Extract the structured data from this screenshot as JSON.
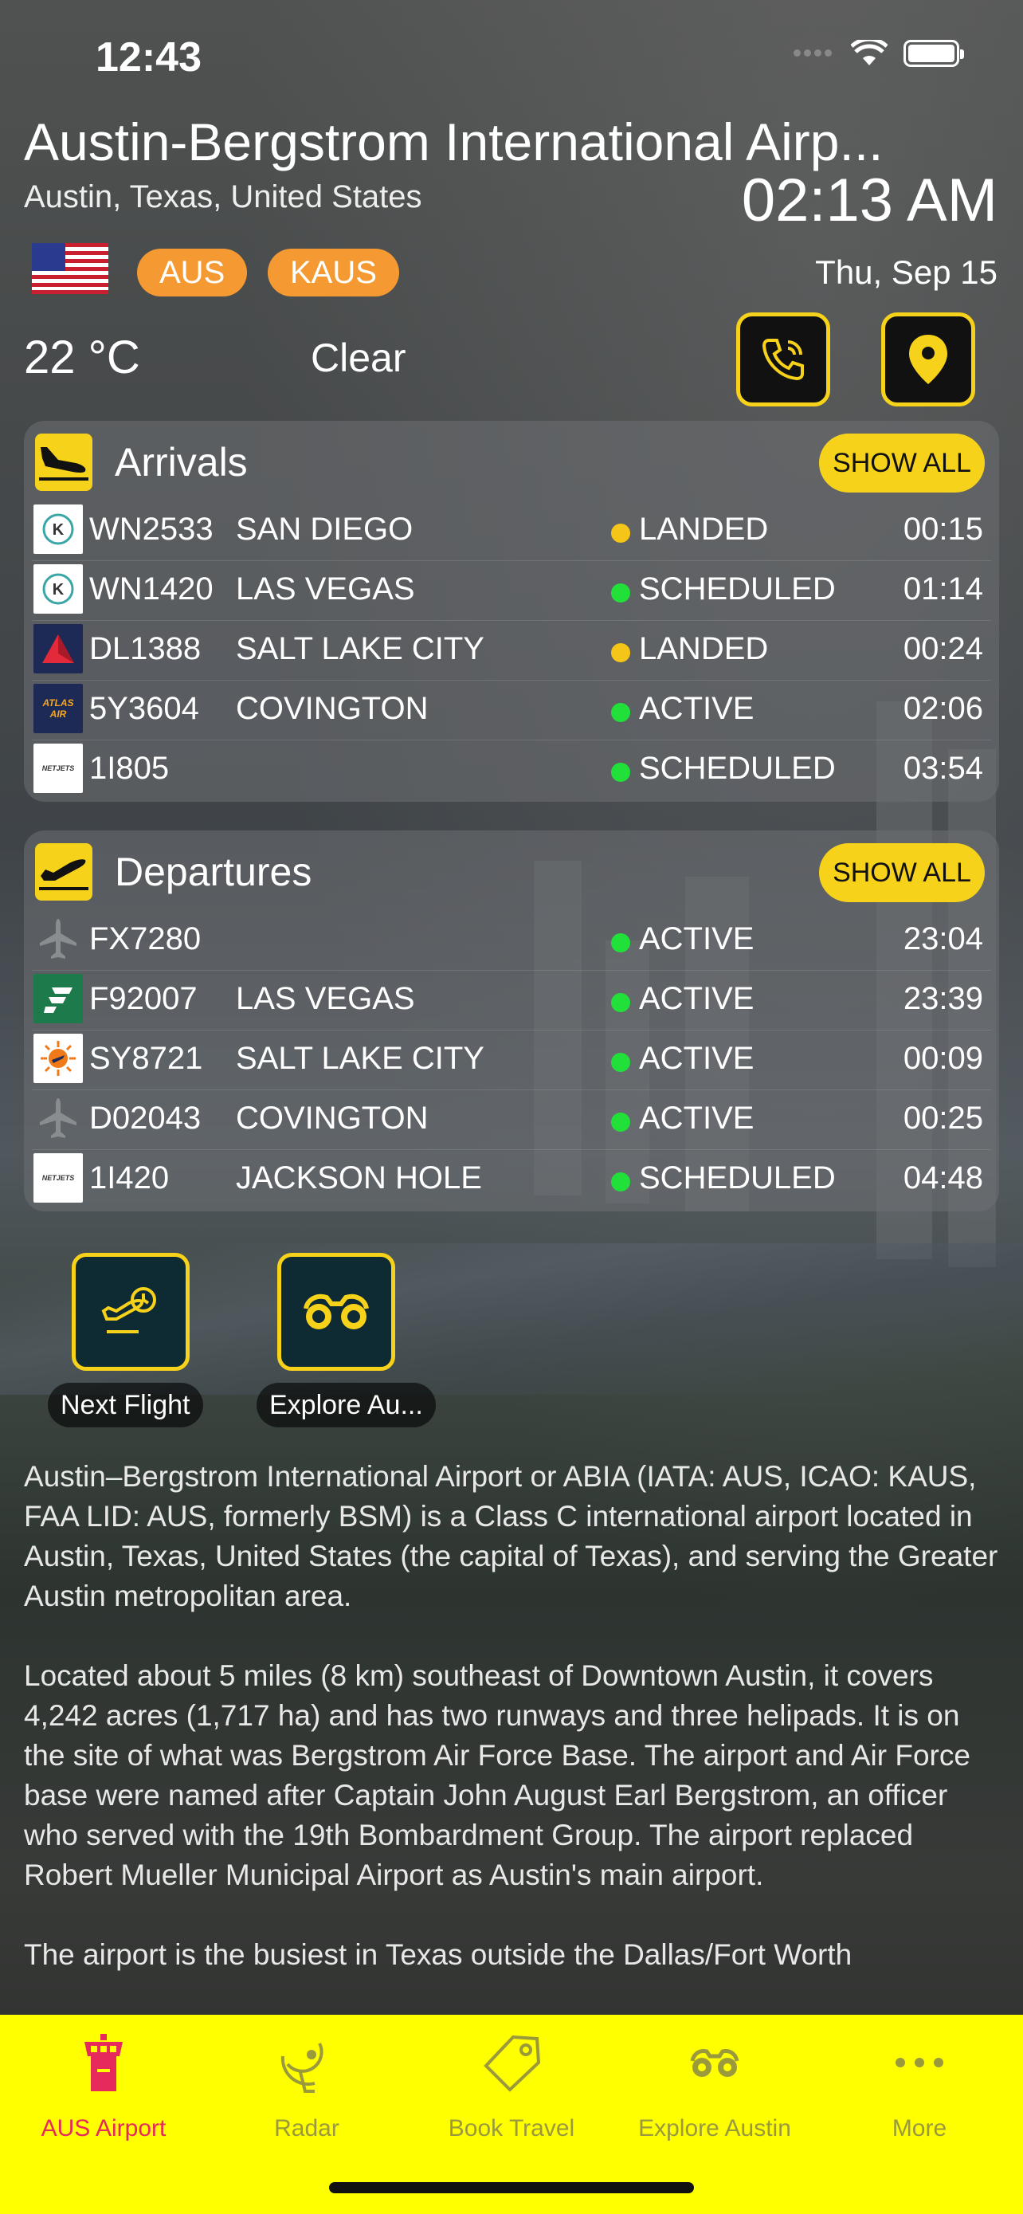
{
  "status_bar": {
    "time": "12:43"
  },
  "airport": {
    "name": "Austin-Bergstrom International Airp...",
    "location": "Austin, Texas, United States",
    "local_time": "02:13 AM",
    "date": "Thu, Sep 15",
    "iata": "AUS",
    "icao": "KAUS",
    "temperature": "22 °C",
    "condition": "Clear"
  },
  "arrivals": {
    "title": "Arrivals",
    "show_all": "SHOW ALL",
    "rows": [
      {
        "flight": "WN2533",
        "city": "SAN DIEGO",
        "status": "LANDED",
        "time": "00:15",
        "dot": "#f5c518",
        "logo": "k-icon"
      },
      {
        "flight": "WN1420",
        "city": "LAS VEGAS",
        "status": "SCHEDULED",
        "time": "01:14",
        "dot": "#22e03a",
        "logo": "k-icon"
      },
      {
        "flight": "DL1388",
        "city": "SALT LAKE CITY",
        "status": "LANDED",
        "time": "00:24",
        "dot": "#f5c518",
        "logo": "delta-icon"
      },
      {
        "flight": "5Y3604",
        "city": "COVINGTON",
        "status": "ACTIVE",
        "time": "02:06",
        "dot": "#22e03a",
        "logo": "atlas-air-icon"
      },
      {
        "flight": "1I805",
        "city": "",
        "status": "SCHEDULED",
        "time": "03:54",
        "dot": "#22e03a",
        "logo": "netjets-icon"
      }
    ]
  },
  "departures": {
    "title": "Departures",
    "show_all": "SHOW ALL",
    "rows": [
      {
        "flight": "FX7280",
        "city": "",
        "status": "ACTIVE",
        "time": "23:04",
        "dot": "#22e03a",
        "logo": "plane-icon"
      },
      {
        "flight": "F92007",
        "city": "LAS VEGAS",
        "status": "ACTIVE",
        "time": "23:39",
        "dot": "#22e03a",
        "logo": "frontier-icon"
      },
      {
        "flight": "SY8721",
        "city": "SALT LAKE CITY",
        "status": "ACTIVE",
        "time": "00:09",
        "dot": "#22e03a",
        "logo": "sun-country-icon"
      },
      {
        "flight": "D02043",
        "city": "COVINGTON",
        "status": "ACTIVE",
        "time": "00:25",
        "dot": "#22e03a",
        "logo": "plane-icon"
      },
      {
        "flight": "1I420",
        "city": "JACKSON HOLE",
        "status": "SCHEDULED",
        "time": "04:48",
        "dot": "#22e03a",
        "logo": "netjets-icon"
      }
    ]
  },
  "logo_labels": {
    "k": "K",
    "atlas": "ATLAS AIR",
    "netjets": "NETJETS"
  },
  "actions": {
    "next_flight": "Next Flight",
    "explore": "Explore Au..."
  },
  "description": [
    "Austin–Bergstrom International Airport or ABIA (IATA: AUS, ICAO: KAUS, FAA LID: AUS, formerly BSM) is a Class C international airport located in Austin, Texas, United States (the capital of Texas), and serving the Greater Austin metropolitan area.",
    "Located about 5 miles (8 km) southeast of Downtown Austin, it covers 4,242 acres (1,717 ha) and has two runways and three helipads. It is on the site of what was Bergstrom Air Force Base. The airport and Air Force base were named after Captain John August Earl Bergstrom, an officer who served with the 19th Bombardment Group. The airport replaced Robert Mueller Municipal Airport as Austin's main airport.",
    "The airport is the busiest in Texas outside the Dallas/Fort Worth"
  ],
  "tabbar": {
    "active_color": "#e62a5c",
    "items": [
      {
        "label": "AUS Airport",
        "icon": "control-tower-icon",
        "active": true
      },
      {
        "label": "Radar",
        "icon": "radar-icon",
        "active": false
      },
      {
        "label": "Book Travel",
        "icon": "tag-icon",
        "active": false
      },
      {
        "label": "Explore Austin",
        "icon": "binoculars-icon",
        "active": false
      },
      {
        "label": "More",
        "icon": "more-icon",
        "active": false
      }
    ]
  }
}
